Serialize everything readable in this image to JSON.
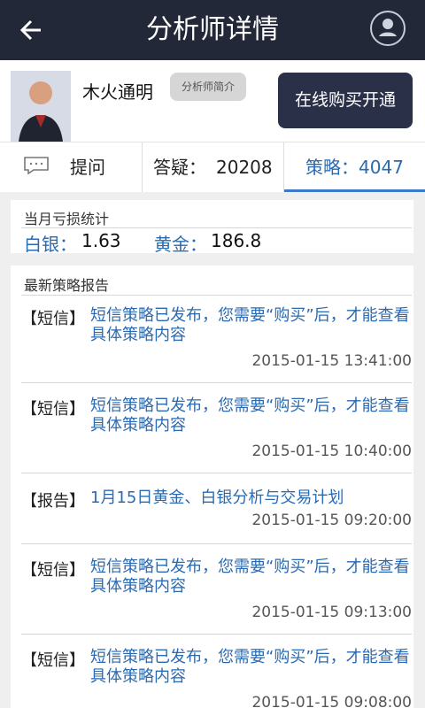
{
  "header": {
    "title": "分析师详情"
  },
  "profile": {
    "name": "木火通明",
    "intro_button": "分析师简介",
    "buy_button": "在线购买开通"
  },
  "tabs": {
    "ask": "提问",
    "qa_label": "答疑：",
    "qa_value": "20208",
    "strategy": "策略：4047"
  },
  "stats": {
    "title": "当月亏损统计",
    "silver_label": "白银：",
    "silver_value": "1.63",
    "gold_label": "黄金：",
    "gold_value": "186.8"
  },
  "reports": {
    "title": "最新策略报告",
    "items": [
      {
        "type": "【短信】",
        "text": "短信策略已发布，您需要“购买”后，才能查看具体策略内容",
        "time": "2015-01-15 13:41:00"
      },
      {
        "type": "【短信】",
        "text": "短信策略已发布，您需要“购买”后，才能查看具体策略内容",
        "time": "2015-01-15 10:40:00"
      },
      {
        "type": "【报告】",
        "text": "1月15日黄金、白银分析与交易计划",
        "time": "2015-01-15 09:20:00"
      },
      {
        "type": "【短信】",
        "text": "短信策略已发布，您需要“购买”后，才能查看具体策略内容",
        "time": "2015-01-15 09:13:00"
      },
      {
        "type": "【短信】",
        "text": "短信策略已发布，您需要“购买”后，才能查看具体策略内容",
        "time": "2015-01-15 09:08:00"
      }
    ]
  },
  "icons": {
    "back": "back-arrow-icon",
    "user": "user-icon",
    "ask": "chat-icon"
  },
  "colors": {
    "header": "#232838",
    "accent": "#2a6ab2",
    "buy_button": "#2a3048"
  }
}
